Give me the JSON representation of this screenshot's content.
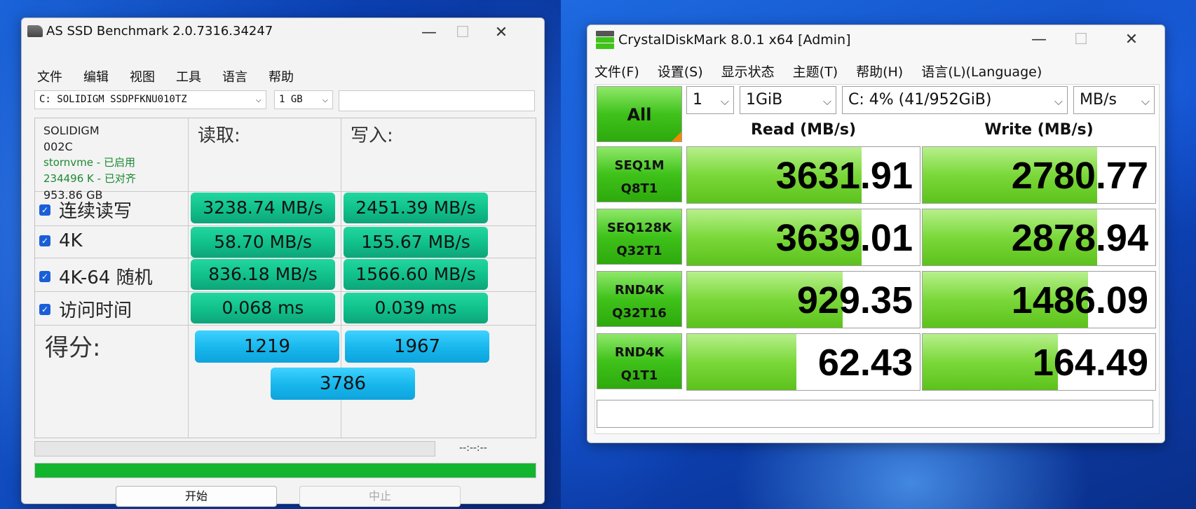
{
  "asssd": {
    "title": "AS SSD Benchmark 2.0.7316.34247",
    "window_controls": {
      "minimize": "—",
      "maximize": "☐",
      "close": "✕"
    },
    "menu": [
      "文件",
      "编辑",
      "视图",
      "工具",
      "语言",
      "帮助"
    ],
    "drive_select": "C: SOLIDIGM SSDPFKNU010TZ",
    "size_select": "1 GB",
    "device": {
      "model": "SOLIDIGM",
      "firmware": "002C",
      "driver": "stornvme - 已启用",
      "alignment": "234496 K - 已对齐",
      "capacity": "953.86 GB"
    },
    "headers": {
      "read": "读取:",
      "write": "写入:"
    },
    "rows": [
      {
        "label": "连续读写",
        "read": "3238.74 MB/s",
        "write": "2451.39 MB/s"
      },
      {
        "label": "4K",
        "read": "58.70 MB/s",
        "write": "155.67 MB/s"
      },
      {
        "label": "4K-64 随机",
        "read": "836.18 MB/s",
        "write": "1566.60 MB/s"
      },
      {
        "label": "访问时间",
        "read": "0.068 ms",
        "write": "0.039 ms"
      }
    ],
    "score_label": "得分:",
    "score_read": "1219",
    "score_write": "1967",
    "score_total": "3786",
    "elapsed": "--:--:--",
    "progress": 1.0,
    "start_button": "开始",
    "stop_button": "中止",
    "colors": {
      "result": "#10c08a",
      "score": "#16b6ec",
      "progress": "#13b52f"
    }
  },
  "cdm": {
    "title": "CrystalDiskMark 8.0.1 x64 [Admin]",
    "window_controls": {
      "minimize": "—",
      "maximize": "☐",
      "close": "✕"
    },
    "menu": [
      "文件(F)",
      "设置(S)",
      "显示状态",
      "主题(T)",
      "帮助(H)",
      "语言(L)(Language)"
    ],
    "all_button": "All",
    "count_select": "1",
    "size_select": "1GiB",
    "drive_select": "C: 4% (41/952GiB)",
    "unit_select": "MB/s",
    "read_header": "Read (MB/s)",
    "write_header": "Write (MB/s)",
    "tests": [
      {
        "line1": "SEQ1M",
        "line2": "Q8T1",
        "read": "3631.91",
        "write": "2780.77",
        "read_fill": 0.75,
        "write_fill": 0.75
      },
      {
        "line1": "SEQ128K",
        "line2": "Q32T1",
        "read": "3639.01",
        "write": "2878.94",
        "read_fill": 0.75,
        "write_fill": 0.75
      },
      {
        "line1": "RND4K",
        "line2": "Q32T16",
        "read": "929.35",
        "write": "1486.09",
        "read_fill": 0.67,
        "write_fill": 0.71
      },
      {
        "line1": "RND4K",
        "line2": "Q1T1",
        "read": "62.43",
        "write": "164.49",
        "read_fill": 0.47,
        "write_fill": 0.58
      }
    ],
    "colors": {
      "bar": "#7bd83a",
      "accent": "#f08a00"
    }
  }
}
